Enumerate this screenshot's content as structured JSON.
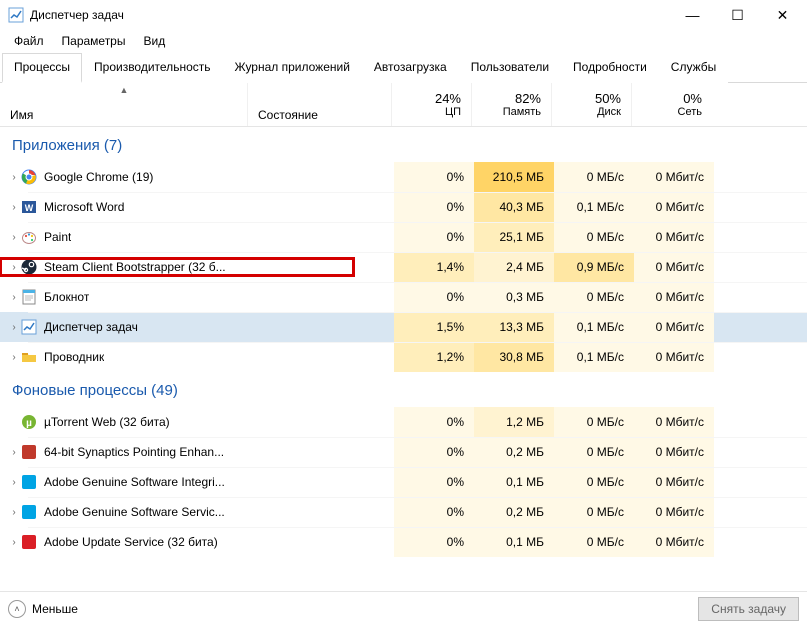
{
  "window": {
    "title": "Диспетчер задач",
    "min": "—",
    "max": "☐",
    "close": "✕"
  },
  "menu": {
    "file": "Файл",
    "options": "Параметры",
    "view": "Вид"
  },
  "tabs": [
    {
      "label": "Процессы",
      "active": true
    },
    {
      "label": "Производительность"
    },
    {
      "label": "Журнал приложений"
    },
    {
      "label": "Автозагрузка"
    },
    {
      "label": "Пользователи"
    },
    {
      "label": "Подробности"
    },
    {
      "label": "Службы"
    }
  ],
  "columns": {
    "name": "Имя",
    "status": "Состояние",
    "cpu": {
      "pct": "24%",
      "label": "ЦП"
    },
    "mem": {
      "pct": "82%",
      "label": "Память"
    },
    "disk": {
      "pct": "50%",
      "label": "Диск"
    },
    "net": {
      "pct": "0%",
      "label": "Сеть"
    }
  },
  "groups": [
    {
      "title": "Приложения (7)",
      "rows": [
        {
          "icon": "chrome",
          "name": "Google Chrome (19)",
          "expand": true,
          "cpu": "0%",
          "mem": "210,5 МБ",
          "disk": "0 МБ/с",
          "net": "0 Мбит/с",
          "heat": {
            "cpu": "h0",
            "mem": "h5",
            "disk": "h0",
            "net": "h0"
          }
        },
        {
          "icon": "word",
          "name": "Microsoft Word",
          "expand": true,
          "cpu": "0%",
          "mem": "40,3 МБ",
          "disk": "0,1 МБ/с",
          "net": "0 Мбит/с",
          "heat": {
            "cpu": "h0",
            "mem": "h3",
            "disk": "h0",
            "net": "h0"
          }
        },
        {
          "icon": "paint",
          "name": "Paint",
          "expand": true,
          "cpu": "0%",
          "mem": "25,1 МБ",
          "disk": "0 МБ/с",
          "net": "0 Мбит/с",
          "heat": {
            "cpu": "h0",
            "mem": "h2",
            "disk": "h0",
            "net": "h0"
          }
        },
        {
          "icon": "steam",
          "name": "Steam Client Bootstrapper (32 б...",
          "expand": true,
          "cpu": "1,4%",
          "mem": "2,4 МБ",
          "disk": "0,9 МБ/с",
          "net": "0 Мбит/с",
          "heat": {
            "cpu": "h2",
            "mem": "h1",
            "disk": "h3",
            "net": "h0"
          },
          "highlight": true
        },
        {
          "icon": "notepad",
          "name": "Блокнот",
          "expand": true,
          "cpu": "0%",
          "mem": "0,3 МБ",
          "disk": "0 МБ/с",
          "net": "0 Мбит/с",
          "heat": {
            "cpu": "h0",
            "mem": "h0",
            "disk": "h0",
            "net": "h0"
          }
        },
        {
          "icon": "taskmgr",
          "name": "Диспетчер задач",
          "expand": true,
          "cpu": "1,5%",
          "mem": "13,3 МБ",
          "disk": "0,1 МБ/с",
          "net": "0 Мбит/с",
          "heat": {
            "cpu": "h2",
            "mem": "h2",
            "disk": "h0",
            "net": "h0"
          },
          "selected": true
        },
        {
          "icon": "explorer",
          "name": "Проводник",
          "expand": true,
          "cpu": "1,2%",
          "mem": "30,8 МБ",
          "disk": "0,1 МБ/с",
          "net": "0 Мбит/с",
          "heat": {
            "cpu": "h2",
            "mem": "h3",
            "disk": "h0",
            "net": "h0"
          }
        }
      ]
    },
    {
      "title": "Фоновые процессы (49)",
      "rows": [
        {
          "icon": "utorrent",
          "name": "µTorrent Web (32 бита)",
          "expand": false,
          "cpu": "0%",
          "mem": "1,2 МБ",
          "disk": "0 МБ/с",
          "net": "0 Мбит/с",
          "heat": {
            "cpu": "h0",
            "mem": "h1",
            "disk": "h0",
            "net": "h0"
          }
        },
        {
          "icon": "synap",
          "name": "64-bit Synaptics Pointing Enhan...",
          "expand": true,
          "cpu": "0%",
          "mem": "0,2 МБ",
          "disk": "0 МБ/с",
          "net": "0 Мбит/с",
          "heat": {
            "cpu": "h0",
            "mem": "h0",
            "disk": "h0",
            "net": "h0"
          }
        },
        {
          "icon": "adobe",
          "name": "Adobe Genuine Software Integri...",
          "expand": true,
          "cpu": "0%",
          "mem": "0,1 МБ",
          "disk": "0 МБ/с",
          "net": "0 Мбит/с",
          "heat": {
            "cpu": "h0",
            "mem": "h0",
            "disk": "h0",
            "net": "h0"
          }
        },
        {
          "icon": "adobe",
          "name": "Adobe Genuine Software Servic...",
          "expand": true,
          "cpu": "0%",
          "mem": "0,2 МБ",
          "disk": "0 МБ/с",
          "net": "0 Мбит/с",
          "heat": {
            "cpu": "h0",
            "mem": "h0",
            "disk": "h0",
            "net": "h0"
          }
        },
        {
          "icon": "adobered",
          "name": "Adobe Update Service (32 бита)",
          "expand": true,
          "cpu": "0%",
          "mem": "0,1 МБ",
          "disk": "0 МБ/с",
          "net": "0 Мбит/с",
          "heat": {
            "cpu": "h0",
            "mem": "h0",
            "disk": "h0",
            "net": "h0"
          }
        }
      ]
    }
  ],
  "footer": {
    "less": "Меньше",
    "endtask": "Снять задачу"
  },
  "icons": {
    "chrome": "#4285f4",
    "word": "#2b579a",
    "paint": "#f2a900",
    "steam": "#1b2838",
    "notepad": "#4bb3e6",
    "taskmgr": "#4a90d9",
    "explorer": "#f5c842",
    "utorrent": "#78b532",
    "synap": "#c0392b",
    "adobe": "#00a4e4",
    "adobered": "#da1f26"
  }
}
